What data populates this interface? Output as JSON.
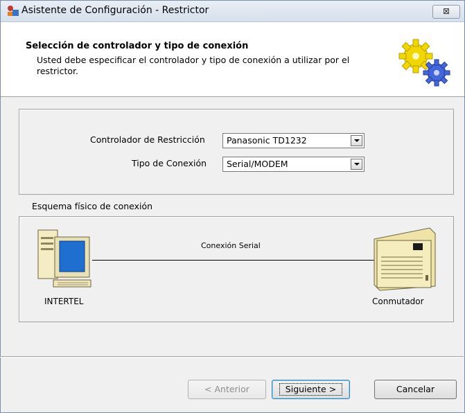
{
  "window": {
    "title": "Asistente de Configuración - Restrictor",
    "close_icon": "close-icon"
  },
  "header": {
    "title": "Selección de controlador y tipo de conexión",
    "description": "Usted debe especificar el controlador y tipo de conexión a utilizar por el restrictor.",
    "icon": "gears-icon"
  },
  "form": {
    "controller_label": "Controlador de Restricción",
    "controller_value": "Panasonic TD1232",
    "connection_label": "Tipo de Conexión",
    "connection_value": "Serial/MODEM"
  },
  "schema": {
    "label": "Esquema físico de conexión",
    "connection_label": "Conexión Serial",
    "computer_label": "INTERTEL",
    "switch_label": "Conmutador"
  },
  "buttons": {
    "back": "< Anterior",
    "next": "Siguiente >",
    "cancel": "Cancelar"
  }
}
